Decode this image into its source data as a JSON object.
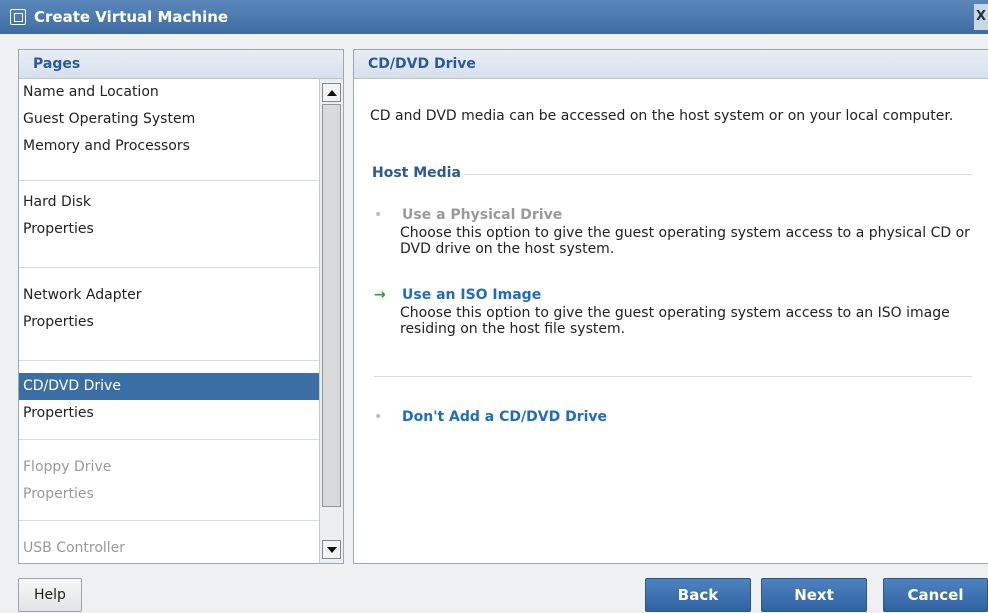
{
  "window": {
    "title": "Create Virtual Machine",
    "close_label": "X"
  },
  "pages": {
    "header": "Pages",
    "groups": [
      {
        "items": [
          {
            "label": "Name and Location",
            "state": "normal"
          },
          {
            "label": "Guest Operating System",
            "state": "normal"
          },
          {
            "label": "Memory and Processors",
            "state": "normal"
          }
        ]
      },
      {
        "items": [
          {
            "label": "Hard Disk",
            "state": "normal"
          },
          {
            "label": "Properties",
            "state": "normal"
          }
        ]
      },
      {
        "items": [
          {
            "label": "Network Adapter",
            "state": "normal"
          },
          {
            "label": "Properties",
            "state": "normal"
          }
        ]
      },
      {
        "items": [
          {
            "label": "CD/DVD Drive",
            "state": "selected"
          },
          {
            "label": "Properties",
            "state": "normal"
          }
        ]
      },
      {
        "items": [
          {
            "label": "Floppy Drive",
            "state": "disabled"
          },
          {
            "label": "Properties",
            "state": "disabled"
          }
        ]
      },
      {
        "items": [
          {
            "label": "USB Controller",
            "state": "disabled"
          }
        ]
      }
    ]
  },
  "content": {
    "header": "CD/DVD Drive",
    "intro": "CD and DVD media can be accessed on the host system or on your local computer.",
    "section_title": "Host Media",
    "options": {
      "physical": {
        "name": "Use a Physical Drive",
        "desc": "Choose this option to give the guest operating system access to a physical CD or DVD drive on the host system.",
        "bullet": "•"
      },
      "iso": {
        "name": "Use an ISO Image",
        "desc": "Choose this option to give the guest operating system access to an ISO image residing on the host file system.",
        "bullet": "→"
      },
      "noadd": {
        "name": "Don't Add a CD/DVD Drive",
        "bullet": "•"
      }
    }
  },
  "buttons": {
    "help": "Help",
    "back": "Back",
    "next": "Next",
    "cancel": "Cancel"
  },
  "colors": {
    "title_bar": "#3e6da3",
    "selected_item": "#3b6ea5",
    "link": "#1f6cc4",
    "arrow": "#2e9a33"
  }
}
